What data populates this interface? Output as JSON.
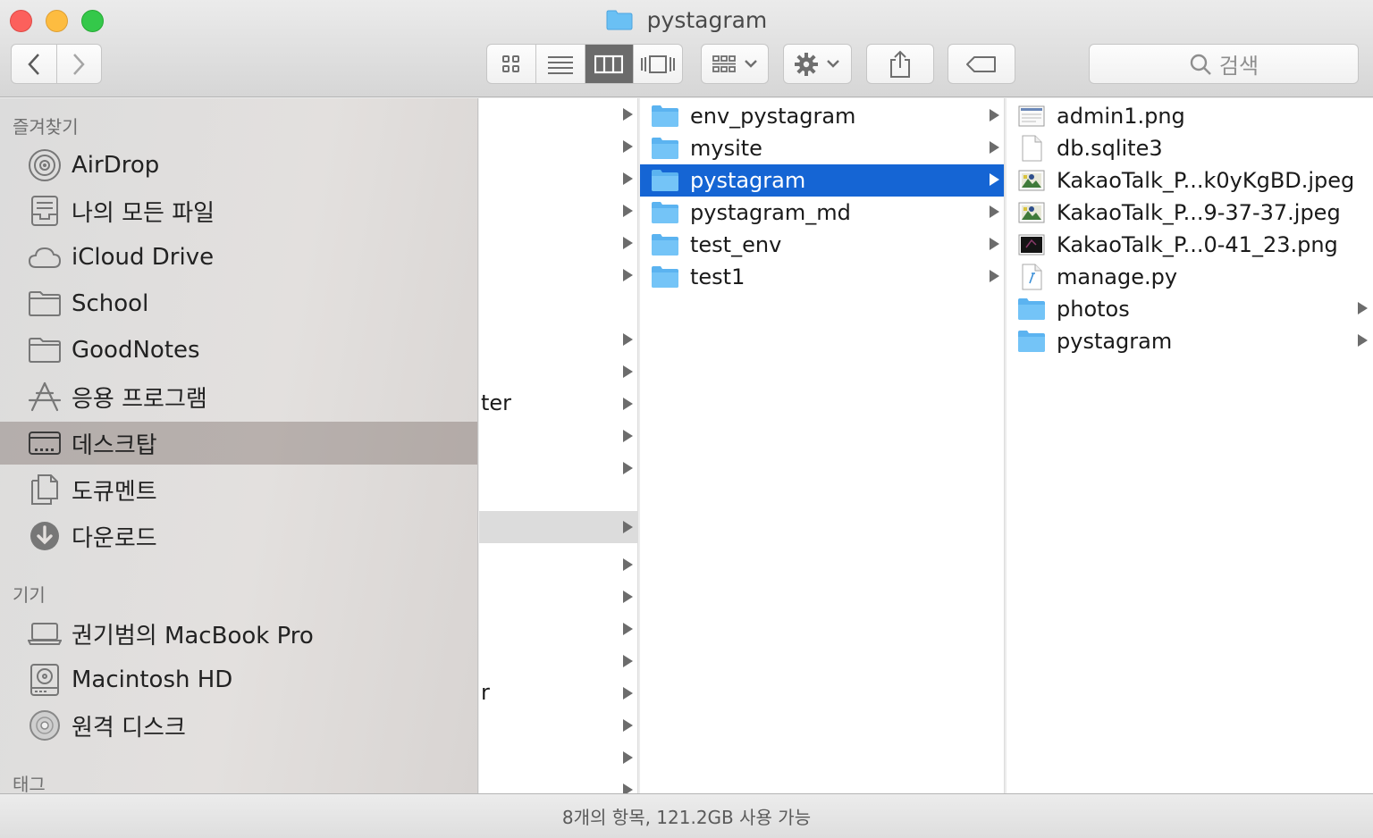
{
  "window": {
    "title": "pystagram"
  },
  "toolbar": {
    "search_label": "검색"
  },
  "sidebar": {
    "favorites_header": "즐겨찾기",
    "favorites": [
      {
        "label": "AirDrop",
        "icon": "airdrop-icon"
      },
      {
        "label": "나의 모든 파일",
        "icon": "all-files-icon"
      },
      {
        "label": "iCloud Drive",
        "icon": "cloud-icon"
      },
      {
        "label": "School",
        "icon": "folder-icon"
      },
      {
        "label": "GoodNotes",
        "icon": "folder-icon"
      },
      {
        "label": "응용 프로그램",
        "icon": "applications-icon"
      },
      {
        "label": "데스크탑",
        "icon": "desktop-icon",
        "selected": true
      },
      {
        "label": "도큐멘트",
        "icon": "documents-icon"
      },
      {
        "label": "다운로드",
        "icon": "downloads-icon"
      }
    ],
    "devices_header": "기기",
    "devices": [
      {
        "label": "권기범의 MacBook Pro",
        "icon": "laptop-icon"
      },
      {
        "label": "Macintosh HD",
        "icon": "hard-drive-icon"
      },
      {
        "label": "원격 디스크",
        "icon": "disc-icon"
      }
    ],
    "tags_header": "태그"
  },
  "column1": {
    "visible_fragments": [
      "ter",
      "r"
    ]
  },
  "column2": {
    "items": [
      {
        "name": "env_pystagram",
        "type": "folder"
      },
      {
        "name": "mysite",
        "type": "folder"
      },
      {
        "name": "pystagram",
        "type": "folder",
        "selected": true
      },
      {
        "name": "pystagram_md",
        "type": "folder"
      },
      {
        "name": "test_env",
        "type": "folder"
      },
      {
        "name": "test1",
        "type": "folder"
      }
    ]
  },
  "column3": {
    "items": [
      {
        "name": "admin1.png",
        "type": "png-image"
      },
      {
        "name": "db.sqlite3",
        "type": "document"
      },
      {
        "name": "KakaoTalk_P...k0yKgBD.jpeg",
        "type": "jpeg-image"
      },
      {
        "name": "KakaoTalk_P...9-37-37.jpeg",
        "type": "jpeg-image"
      },
      {
        "name": "KakaoTalk_P...0-41_23.png",
        "type": "dark-png-image"
      },
      {
        "name": "manage.py",
        "type": "python-script"
      },
      {
        "name": "photos",
        "type": "folder"
      },
      {
        "name": "pystagram",
        "type": "folder"
      }
    ]
  },
  "status": {
    "text": "8개의 항목, 121.2GB 사용 가능"
  },
  "colors": {
    "selection": "#1565d4",
    "folder": "#5bb3f0"
  }
}
